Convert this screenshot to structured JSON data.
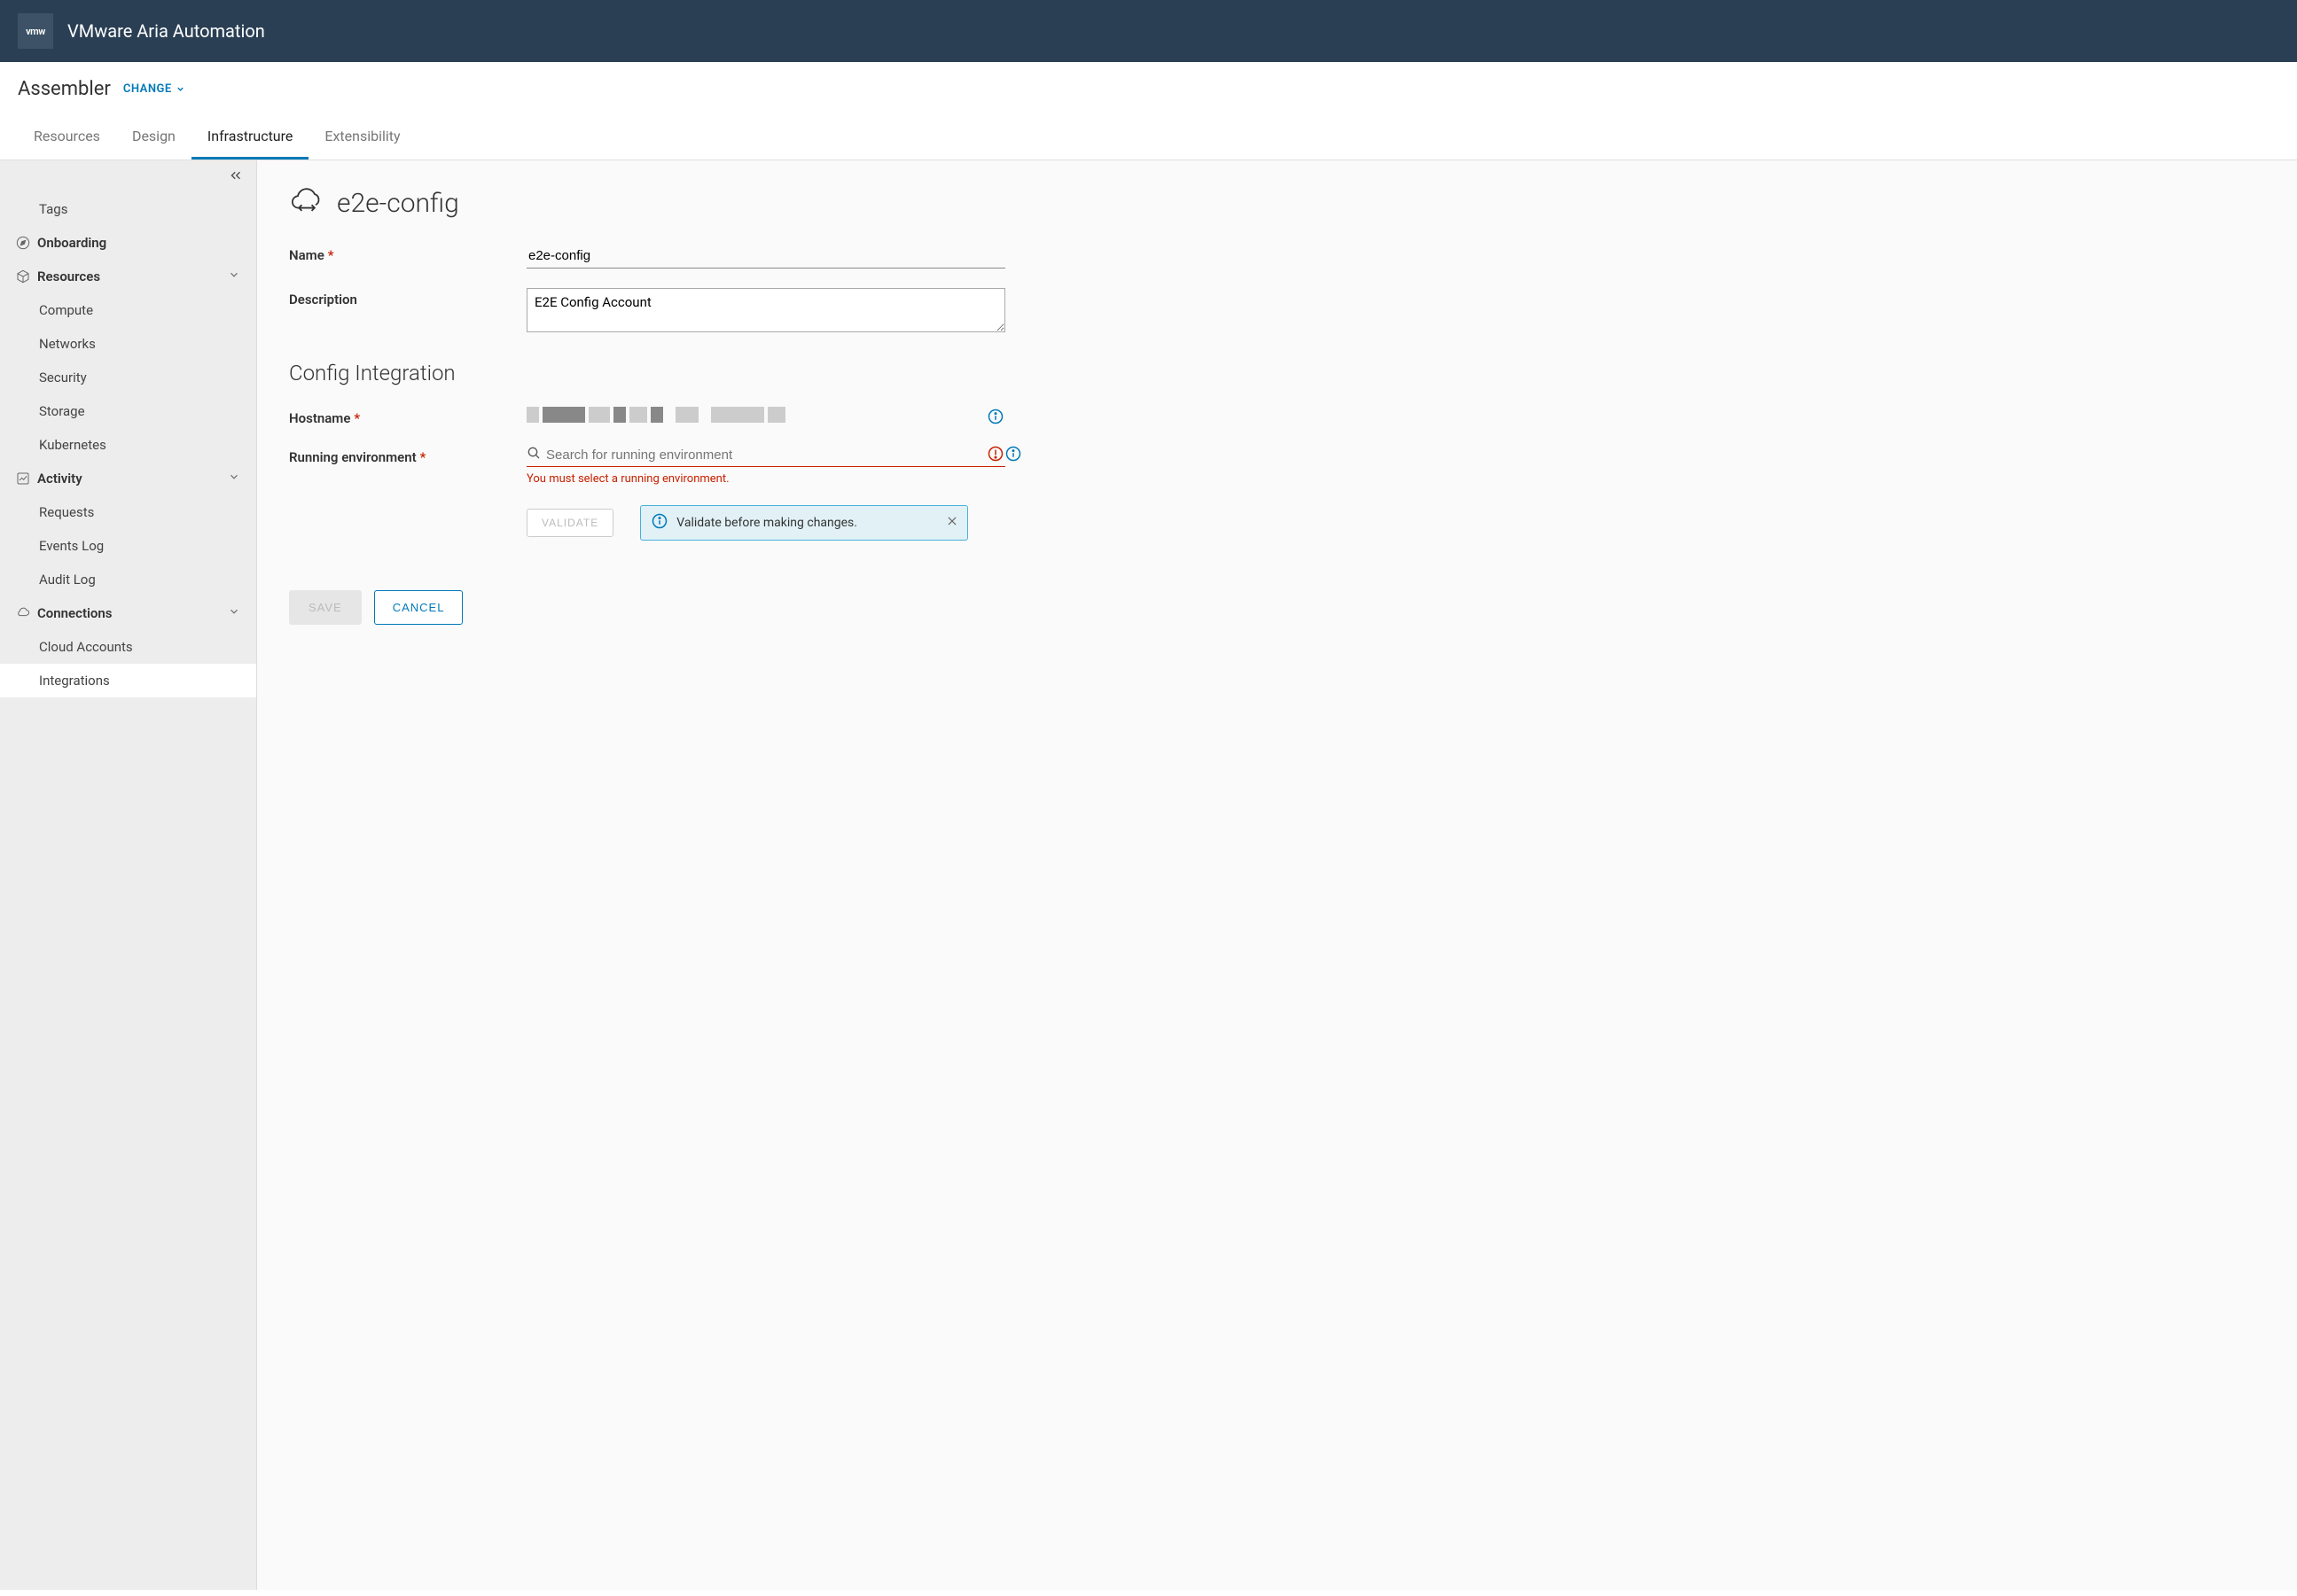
{
  "header": {
    "logo_text": "vmw",
    "product_name": "VMware Aria Automation"
  },
  "sub_header": {
    "title": "Assembler",
    "change_label": "CHANGE"
  },
  "tabs": {
    "resources": "Resources",
    "design": "Design",
    "infrastructure": "Infrastructure",
    "extensibility": "Extensibility"
  },
  "sidebar": {
    "tags": "Tags",
    "onboarding": "Onboarding",
    "resources": "Resources",
    "compute": "Compute",
    "networks": "Networks",
    "security": "Security",
    "storage": "Storage",
    "kubernetes": "Kubernetes",
    "activity": "Activity",
    "requests": "Requests",
    "events_log": "Events Log",
    "audit_log": "Audit Log",
    "connections": "Connections",
    "cloud_accounts": "Cloud Accounts",
    "integrations": "Integrations"
  },
  "page": {
    "title": "e2e-config",
    "form": {
      "name_label": "Name",
      "name_value": "e2e-config",
      "description_label": "Description",
      "description_value": "E2E Config Account",
      "section_heading": "Config Integration",
      "hostname_label": "Hostname",
      "running_env_label": "Running environment",
      "running_env_placeholder": "Search for running environment",
      "running_env_error": "You must select a running environment.",
      "validate_label": "VALIDATE",
      "alert_text": "Validate before making changes.",
      "save_label": "SAVE",
      "cancel_label": "CANCEL"
    }
  }
}
